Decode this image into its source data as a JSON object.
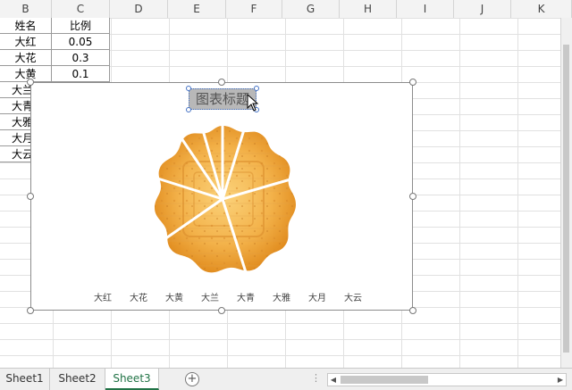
{
  "columns": [
    "B",
    "C",
    "D",
    "E",
    "F",
    "G",
    "H",
    "I",
    "J",
    "K"
  ],
  "table": {
    "headers": [
      "姓名",
      "比例"
    ],
    "rows": [
      {
        "name": "大红",
        "ratio": "0.05"
      },
      {
        "name": "大花",
        "ratio": "0.3"
      },
      {
        "name": "大黄",
        "ratio": "0.1"
      },
      {
        "name": "大兰",
        "ratio": ""
      },
      {
        "name": "大青",
        "ratio": ""
      },
      {
        "name": "大雅",
        "ratio": ""
      },
      {
        "name": "大月",
        "ratio": ""
      },
      {
        "name": "大云",
        "ratio": ""
      }
    ]
  },
  "chart": {
    "title": "图表标题",
    "legend": [
      "大红",
      "大花",
      "大黄",
      "大兰",
      "大青",
      "大雅",
      "大月",
      "大云"
    ],
    "fill": "mooncake-texture",
    "colors": {
      "cake_outer": "#e08a1c",
      "cake_mid": "#f3b24a",
      "cake_inner": "#fbd27a",
      "slice_line": "#ffffff"
    }
  },
  "sheets": [
    {
      "label": "Sheet1",
      "active": false
    },
    {
      "label": "Sheet2",
      "active": false
    },
    {
      "label": "Sheet3",
      "active": true
    }
  ],
  "colors": {
    "accent": "#217346",
    "selection": "#4472c4"
  }
}
